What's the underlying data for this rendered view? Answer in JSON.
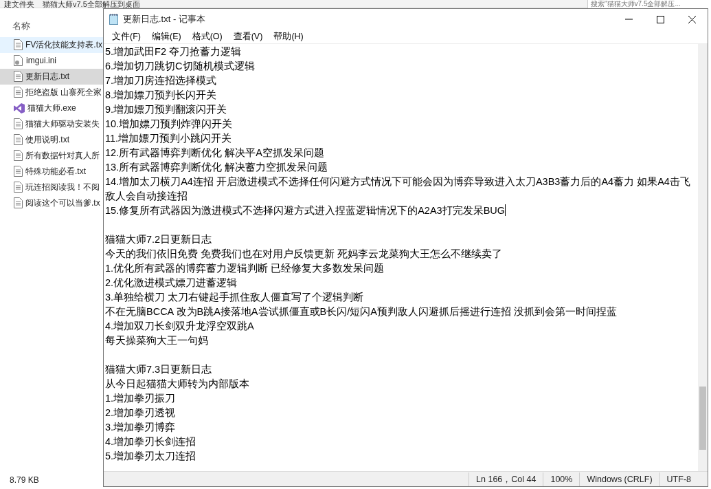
{
  "explorer": {
    "breadcrumb": [
      "建文件夹",
      "猫猫大师v7.5全部解压到桌面"
    ],
    "search": {
      "placeholder": "搜索\"猫猫大师v7.5全部解压..."
    },
    "column_header": "名称",
    "files": [
      {
        "name": "FV活化技能支持表.tx",
        "kind": "text",
        "selected": false,
        "hovered": true
      },
      {
        "name": "imgui.ini",
        "kind": "config",
        "selected": false,
        "hovered": false
      },
      {
        "name": "更新日志.txt",
        "kind": "text",
        "selected": true,
        "hovered": false
      },
      {
        "name": "拒绝盗版 山寨死全家",
        "kind": "text",
        "selected": false,
        "hovered": false
      },
      {
        "name": "猫猫大师.exe",
        "kind": "app",
        "selected": false,
        "hovered": false
      },
      {
        "name": "猫猫大师驱动安装失",
        "kind": "text",
        "selected": false,
        "hovered": false
      },
      {
        "name": "使用说明.txt",
        "kind": "text",
        "selected": false,
        "hovered": false
      },
      {
        "name": "所有数据针对真人所",
        "kind": "text",
        "selected": false,
        "hovered": false
      },
      {
        "name": "特殊功能必看.txt",
        "kind": "text",
        "selected": false,
        "hovered": false
      },
      {
        "name": "玩连招阅读我！不阅",
        "kind": "text",
        "selected": false,
        "hovered": false
      },
      {
        "name": "阅读这个可以当爹.tx",
        "kind": "text",
        "selected": false,
        "hovered": false
      }
    ],
    "status_size": "8.79 KB"
  },
  "notepad": {
    "title": "更新日志.txt - 记事本",
    "menu": [
      "文件(F)",
      "编辑(E)",
      "格式(O)",
      "查看(V)",
      "帮助(H)"
    ],
    "blocks": [
      [
        "5.增加武田F2 夺刀抢蓄力逻辑",
        "6.增加切刀跳切C切随机模式逻辑",
        "7.增加刀房连招选择模式",
        "8.增加嫖刀预判长闪开关",
        "9.增加嫖刀预判翻滚闪开关",
        "10.增加嫖刀预判炸弹闪开关",
        "11.增加嫖刀预判小跳闪开关",
        "12.所有武器博弈判断优化 解决平A空抓发呆问题",
        "13.所有武器博弈判断优化 解决蓄力空抓发呆问题",
        "14.增加太刀横刀A4连招 开启激进模式不选择任何闪避方式情况下可能会因为博弈导致进入太刀A3B3蓄力后的A4蓄力 如果A4击飞敌人会自动接连招",
        "15.修复所有武器因为激进模式不选择闪避方式进入捏蓝逻辑情况下的A2A3打完发呆BUG"
      ],
      [
        "猫猫大师7.2日更新日志",
        "今天的我们依旧免费 免费我们也在对用户反馈更新 死妈李云龙菜狗大王怎么不继续卖了",
        "1.优化所有武器的博弈蓄力逻辑判断 已经修复大多数发呆问题",
        "2.优化激进模式嫖刀进蓄逻辑",
        "3.单独给横刀 太刀右键起手抓住敌人僵直写了个逻辑判断",
        "不在无脑BCCA 改为B跳A接落地A尝试抓僵直或B长闪/短闪A预判敌人闪避抓后摇进行连招 没抓到会第一时间捏蓝",
        "4.增加双刀长剑双升龙浮空双跳A",
        "每天操菜狗大王一句妈"
      ],
      [
        "猫猫大师7.3日更新日志",
        "从今日起猫猫大师转为内部版本",
        "1.增加拳刃振刀",
        "2.增加拳刃透视",
        "3.增加拳刃博弈",
        "4.增加拳刃长剑连招",
        "5.增加拳刃太刀连招"
      ]
    ],
    "status_bar": [
      "Ln 166，Col 44",
      "100%",
      "Windows (CRLF)",
      "UTF-8"
    ]
  }
}
